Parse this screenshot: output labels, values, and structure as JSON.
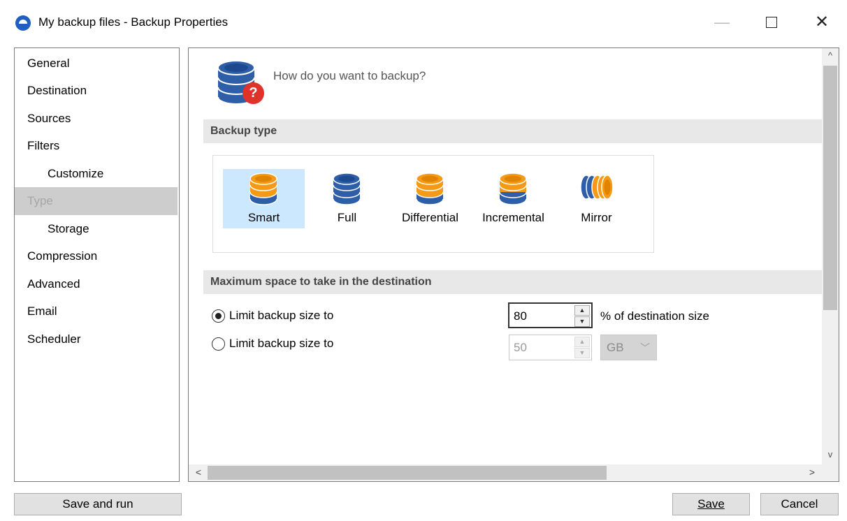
{
  "window": {
    "title": "My backup files - Backup Properties",
    "minimize": "—",
    "close": "✕"
  },
  "nav": {
    "items": [
      {
        "label": "General"
      },
      {
        "label": "Destination"
      },
      {
        "label": "Sources"
      },
      {
        "label": "Filters"
      },
      {
        "label": "Customize"
      },
      {
        "label": "Type"
      },
      {
        "label": "Storage"
      },
      {
        "label": "Compression"
      },
      {
        "label": "Advanced"
      },
      {
        "label": "Email"
      },
      {
        "label": "Scheduler"
      }
    ],
    "selected": "Type"
  },
  "header": {
    "question": "How do you want to backup?",
    "badge": "?"
  },
  "backup_type": {
    "section_title": "Backup type",
    "options": [
      {
        "label": "Smart",
        "selected": true
      },
      {
        "label": "Full"
      },
      {
        "label": "Differential"
      },
      {
        "label": "Incremental"
      },
      {
        "label": "Mirror"
      }
    ]
  },
  "max_space": {
    "section_title": "Maximum space to take in the destination",
    "option1_label": "Limit backup size to",
    "option1_value": "80",
    "option1_unit": "% of destination size",
    "option2_label": "Limit backup size to",
    "option2_value": "50",
    "option2_unit": "GB",
    "selected_option": 1
  },
  "scroll": {
    "up": "^",
    "down": "v",
    "left": "<",
    "right": ">"
  },
  "buttons": {
    "save_and_run": "Save and run",
    "save": "Save",
    "cancel": "Cancel"
  },
  "colors": {
    "blue_db": "#2f5ea8",
    "orange_db": "#f59a16",
    "selected_bg": "#cce8ff"
  }
}
